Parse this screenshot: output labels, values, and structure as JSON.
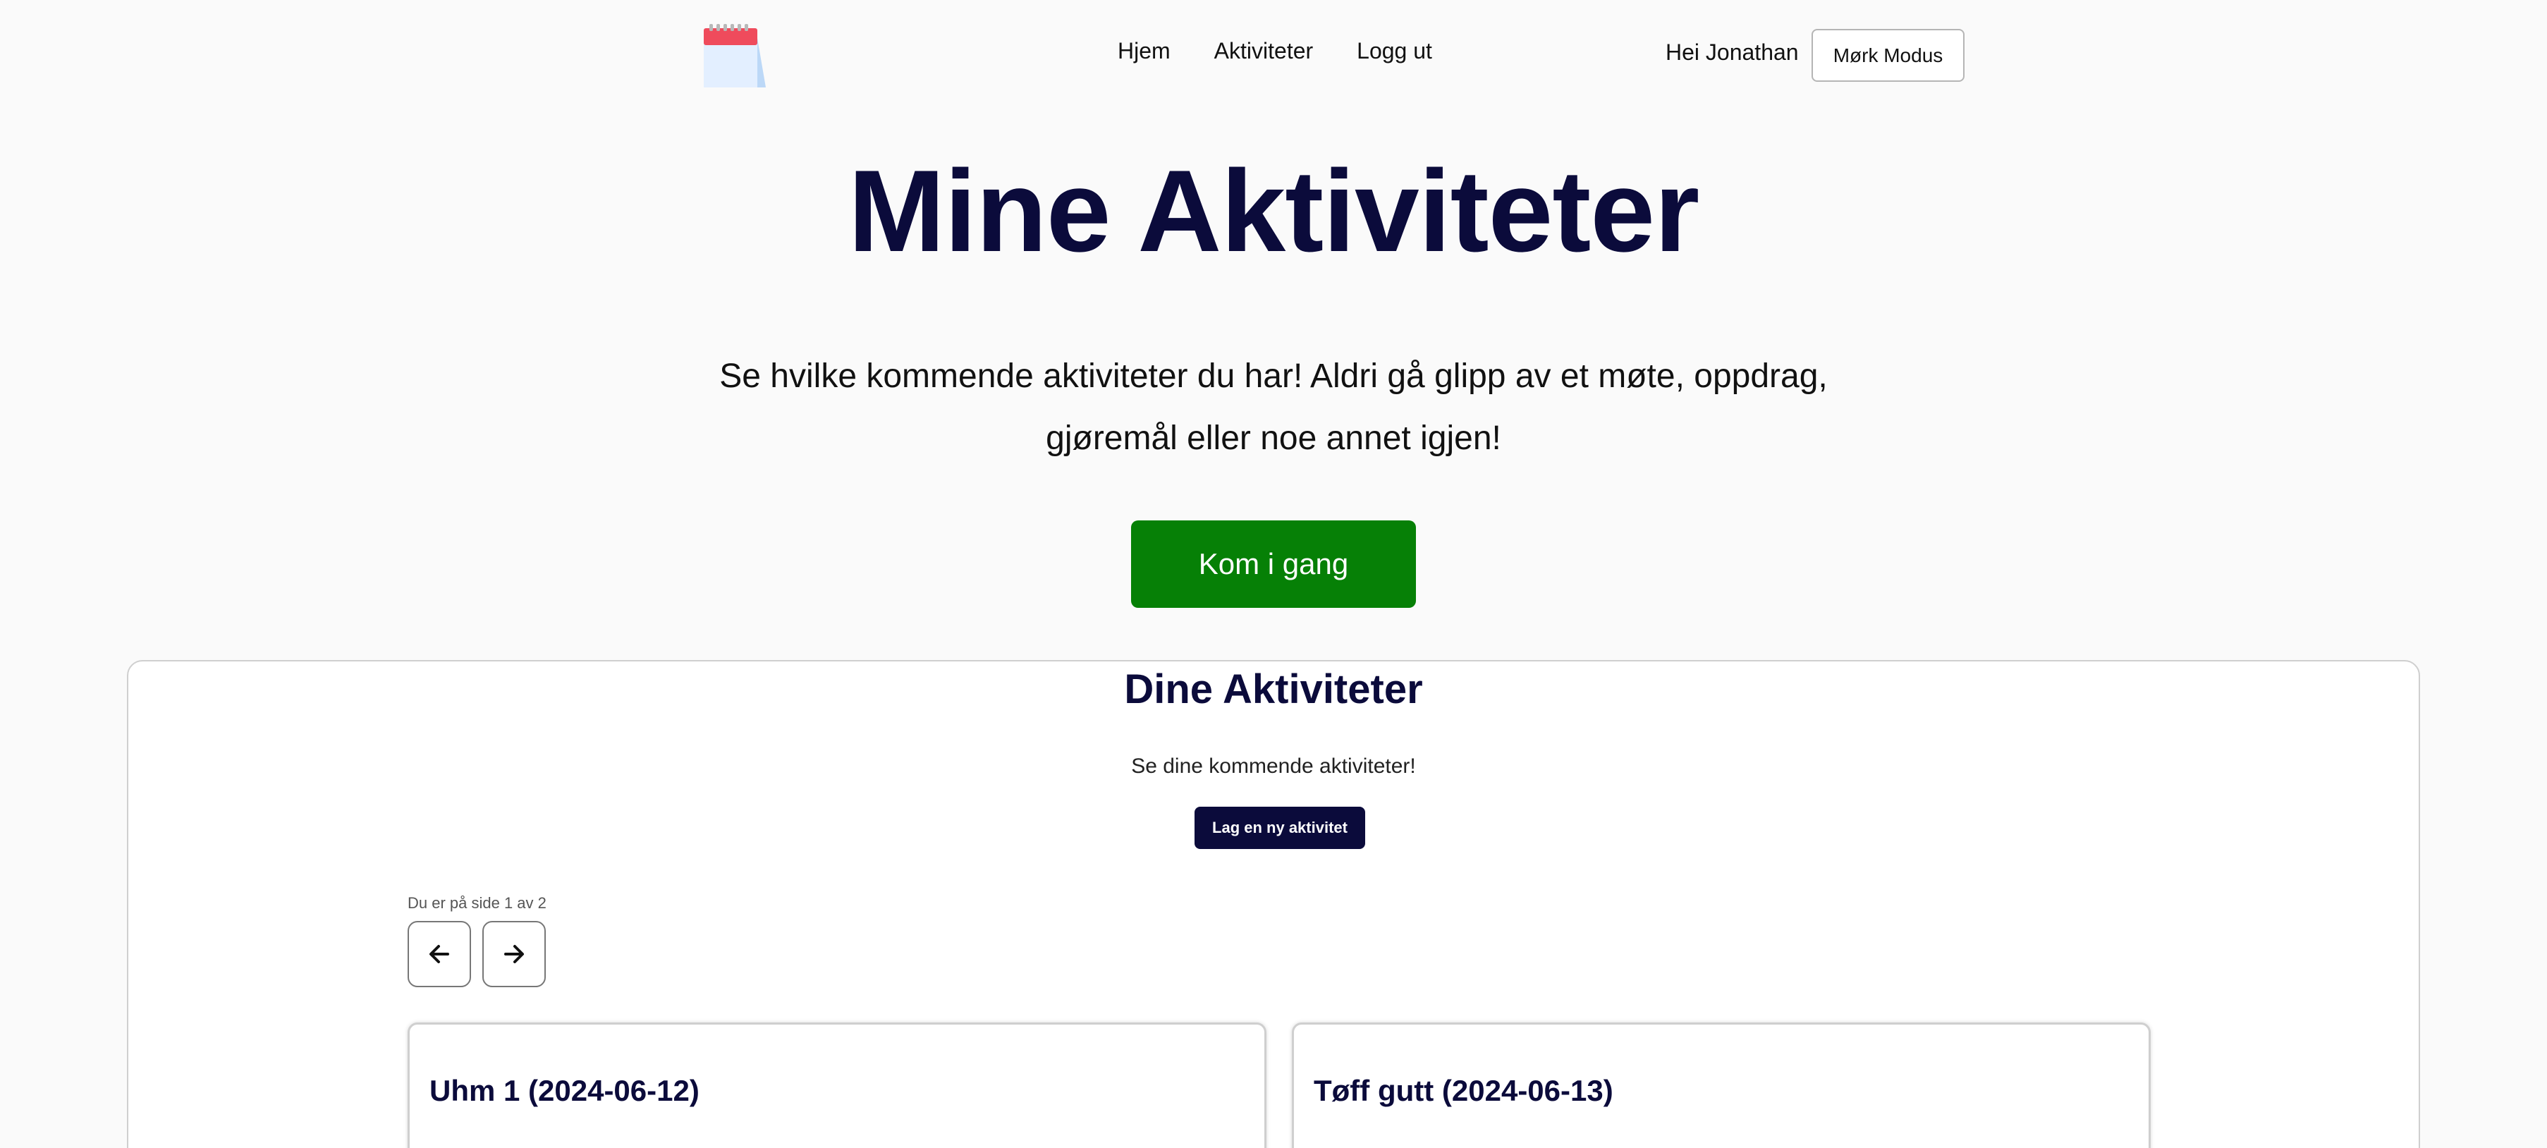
{
  "nav": {
    "items": [
      "Hjem",
      "Aktiviteter",
      "Logg ut"
    ]
  },
  "user": {
    "greeting": "Hei Jonathan",
    "dark_mode_label": "Mørk Modus"
  },
  "hero": {
    "title": "Mine Aktiviteter",
    "line1": "Se hvilke kommende aktiviteter du har! Aldri gå glipp av et møte, oppdrag,",
    "line2": "gjøremål eller noe annet igjen!",
    "cta_label": "Kom i gang"
  },
  "activities": {
    "title": "Dine Aktiviteter",
    "subtitle": "Se dine kommende aktiviteter!",
    "new_button": "Lag en ny aktivitet",
    "page_info": "Du er på side 1 av 2",
    "cards": [
      {
        "title": "Uhm 1 (2024-06-12)"
      },
      {
        "title": "Tøff gutt (2024-06-13)"
      }
    ]
  },
  "colors": {
    "primary": "#0b0b3b",
    "cta": "#068006",
    "logo_red": "#ef4b5c",
    "logo_blue": "#cfe3fb"
  },
  "icons": [
    "calendar-logo-icon",
    "arrow-left-icon",
    "arrow-right-icon"
  ]
}
